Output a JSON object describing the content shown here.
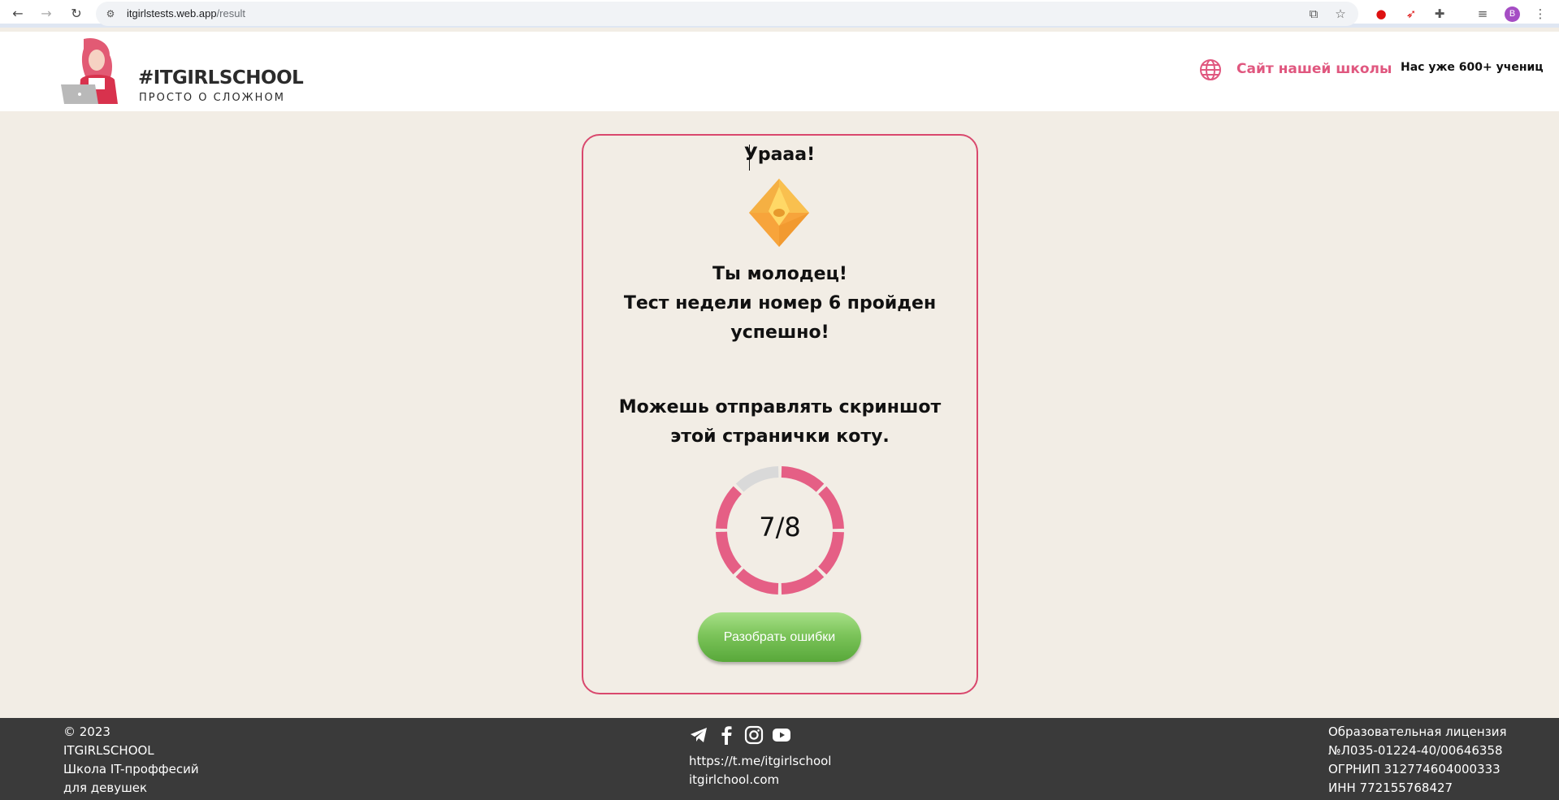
{
  "browser": {
    "url_host": "itgirlstests.web.app",
    "url_path": "/result",
    "profile_initial": "B"
  },
  "header": {
    "logo_title": "#ITGIRLSCHOOL",
    "logo_subtitle": "ПРОСТО О СЛОЖНОМ",
    "school_link": "Сайт нашей школы",
    "students": "Нас уже 600+ учениц"
  },
  "result": {
    "heading": "Урааа!",
    "message_line1": "Ты молодец!",
    "message_line2": "Тест недели номер 6 пройден успешно!",
    "share_text": "Можешь отправлять скриншот этой странички коту.",
    "score_text": "7/8",
    "score_correct": 7,
    "score_total": 8,
    "review_button": "Разобрать ошибки"
  },
  "colors": {
    "accent": "#e0577f",
    "ring_done": "#e55f85",
    "ring_missed": "#d9d9d9",
    "button_green": "#6dbb4d",
    "footer_bg": "#3a3a3a"
  },
  "footer": {
    "copyright": "© 2023",
    "brand": "ITGIRLSCHOOL",
    "tagline1": "Школа IT-проффесий",
    "tagline2": "для девушек",
    "social_icons": [
      "telegram-icon",
      "facebook-icon",
      "instagram-icon",
      "youtube-icon"
    ],
    "telegram_link": "https://t.me/itgirlschool",
    "site_link": "itgirlchool.com",
    "license1": "Образовательная лицензия",
    "license2": "№Л035-01224-40/00646358",
    "ogrnip": "ОГРНИП 312774604000333",
    "inn": "ИНН 772155768427"
  }
}
